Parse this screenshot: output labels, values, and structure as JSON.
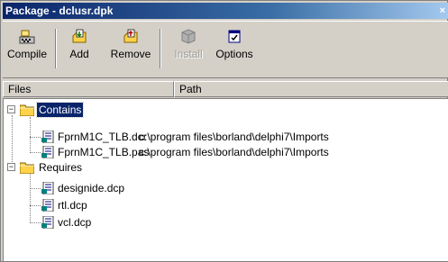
{
  "window": {
    "title": "Package - dclusr.dpk",
    "close_glyph": "×"
  },
  "toolbar": {
    "compile_label": "Compile",
    "add_label": "Add",
    "remove_label": "Remove",
    "install_label": "Install",
    "options_label": "Options",
    "install_enabled": false
  },
  "columns": {
    "files": "Files",
    "path": "Path"
  },
  "tree": {
    "contains": {
      "label": "Contains",
      "expander": "−",
      "selected": true,
      "items": [
        {
          "name": "FprnM1C_TLB.dcr",
          "path": "c:\\program files\\borland\\delphi7\\Imports"
        },
        {
          "name": "FprnM1C_TLB.pas",
          "path": "c:\\program files\\borland\\delphi7\\Imports"
        }
      ]
    },
    "requires": {
      "label": "Requires",
      "expander": "−",
      "items": [
        {
          "name": "designide.dcp"
        },
        {
          "name": "rtl.dcp"
        },
        {
          "name": "vcl.dcp"
        }
      ]
    }
  },
  "colors": {
    "title_start": "#0a246a",
    "title_end": "#a6caf0",
    "selection": "#0a246a",
    "face": "#d4d0c8"
  }
}
